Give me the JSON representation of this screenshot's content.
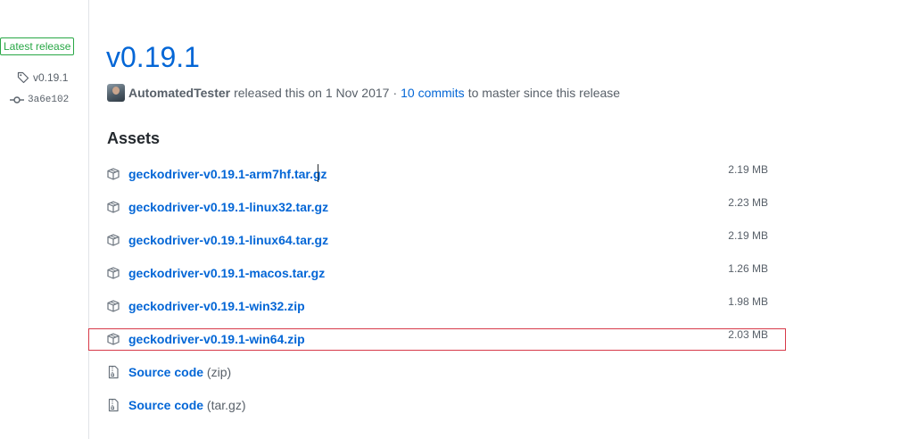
{
  "sidebar": {
    "badge": "Latest release",
    "tag": "v0.19.1",
    "commit": "3a6e102"
  },
  "release": {
    "title": "v0.19.1",
    "author": "AutomatedTester",
    "released_text": "released this on 1 Nov 2017",
    "separator": "·",
    "commits_link": "10 commits",
    "commits_suffix": "to master since this release"
  },
  "assets": {
    "heading": "Assets",
    "items": [
      {
        "name": "geckodriver-v0.19.1-arm7hf.tar.gz",
        "size": "2.19 MB"
      },
      {
        "name": "geckodriver-v0.19.1-linux32.tar.gz",
        "size": "2.23 MB"
      },
      {
        "name": "geckodriver-v0.19.1-linux64.tar.gz",
        "size": "2.19 MB"
      },
      {
        "name": "geckodriver-v0.19.1-macos.tar.gz",
        "size": "1.26 MB"
      },
      {
        "name": "geckodriver-v0.19.1-win32.zip",
        "size": "1.98 MB"
      },
      {
        "name": "geckodriver-v0.19.1-win64.zip",
        "size": "2.03 MB",
        "highlighted": true
      }
    ],
    "source": [
      {
        "label": "Source code",
        "ext": "(zip)"
      },
      {
        "label": "Source code",
        "ext": "(tar.gz)"
      }
    ]
  },
  "icons": {
    "tag": "tag-icon",
    "commit": "git-commit-icon",
    "package": "package-icon",
    "file_zip": "file-zip-icon"
  },
  "colors": {
    "link": "#0366d6",
    "badge_green": "#28a745",
    "highlight_red": "#d73a49",
    "muted": "#586069"
  }
}
